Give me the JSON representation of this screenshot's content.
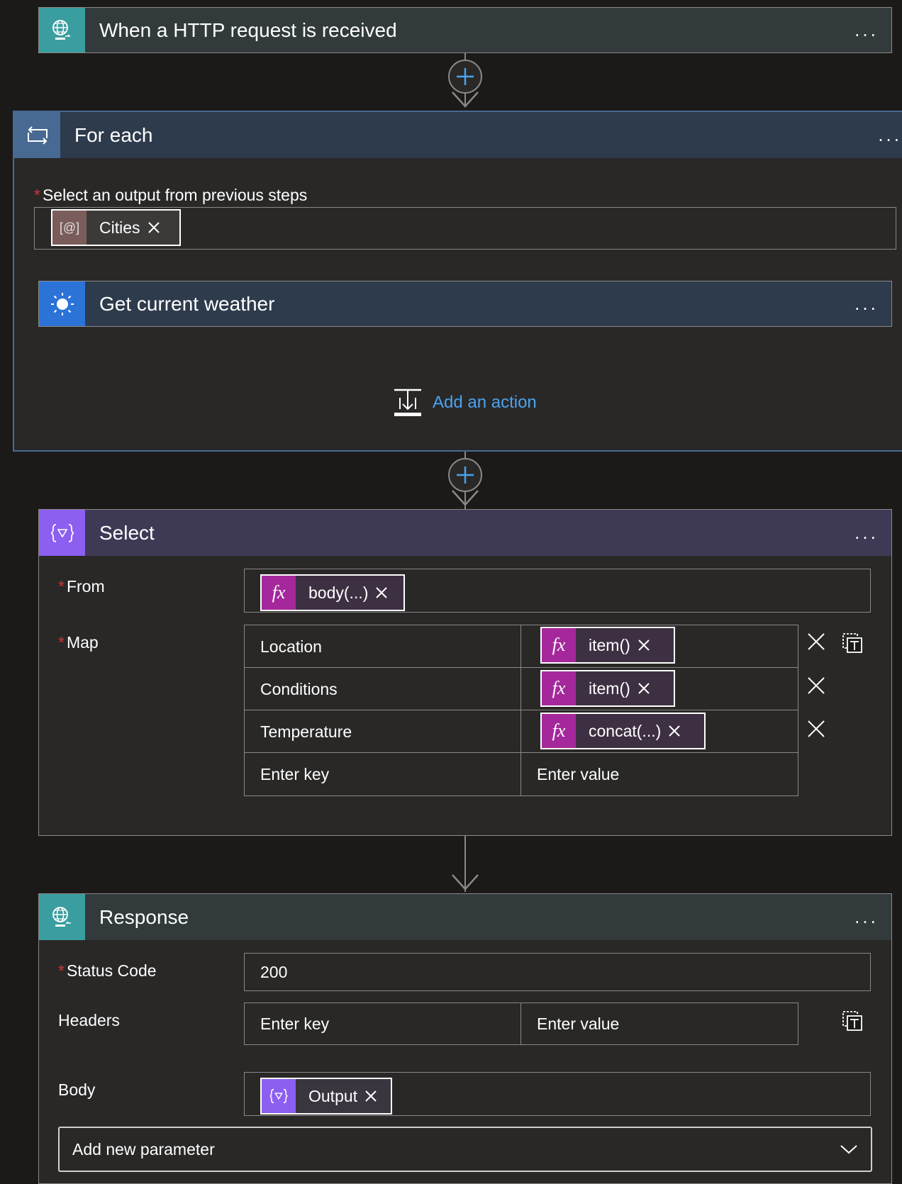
{
  "trigger": {
    "title": "When a HTTP request is received",
    "more": "..."
  },
  "foreach": {
    "title": "For each",
    "more": "...",
    "output_label": "Select an output from previous steps",
    "token_icon": "[@]",
    "token_text": "Cities",
    "inner_action": {
      "title": "Get current weather",
      "more": "..."
    },
    "add_action": "Add an action"
  },
  "select": {
    "title": "Select",
    "more": "...",
    "from_label": "From",
    "from_token": "body(...)",
    "map_label": "Map",
    "rows": [
      {
        "key": "Location",
        "value_token": "item()"
      },
      {
        "key": "Conditions",
        "value_token": "item()"
      },
      {
        "key": "Temperature",
        "value_token": "concat(...)"
      }
    ],
    "key_placeholder": "Enter key",
    "value_placeholder": "Enter value"
  },
  "response": {
    "title": "Response",
    "more": "...",
    "status_label": "Status Code",
    "status_value": "200",
    "headers_label": "Headers",
    "key_placeholder": "Enter key",
    "value_placeholder": "Enter value",
    "body_label": "Body",
    "body_token": "Output",
    "add_param": "Add new parameter"
  },
  "colors": {
    "trigger_icon_bg": "#3a9ea0",
    "foreach_icon_bg": "#486991",
    "weather_icon_bg": "#2c73d8",
    "select_icon_bg": "#8c5ff0",
    "expression_token": "#a4289c",
    "accent_link": "#4aa3f0"
  }
}
